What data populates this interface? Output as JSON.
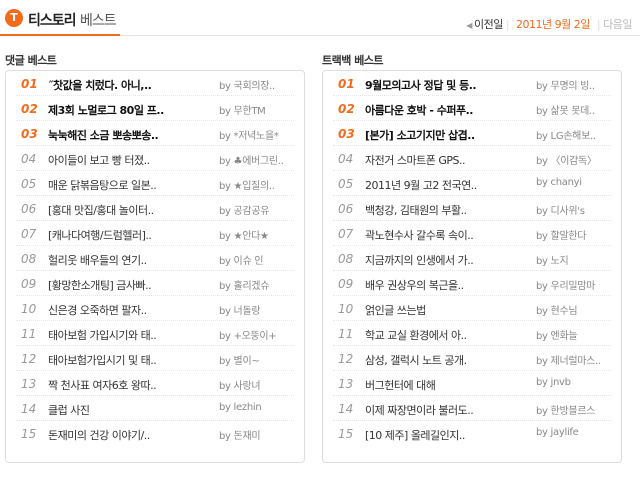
{
  "header": {
    "logo_char": "T",
    "brand_main": "티스토리",
    "brand_sub": "베스트",
    "prev_label": "이전일",
    "date": "2011년 9월 2일",
    "next_label": "다음일"
  },
  "colors": {
    "accent": "#f26b1d"
  },
  "comment_best": {
    "title": "댓글 베스트",
    "items": [
      {
        "rank": "01",
        "title": "˝찻값을 치렀다. 아니,..",
        "author": "by 국회의장.."
      },
      {
        "rank": "02",
        "title": "제3회 노멀로그 80일 프..",
        "author": "by 무한TM"
      },
      {
        "rank": "03",
        "title": "눅눅해진 소금 뽀송뽀송..",
        "author": "by *저녁노을*"
      },
      {
        "rank": "04",
        "title": "아이들이 보고 빵 터졌..",
        "author": "by ♣에버그린.."
      },
      {
        "rank": "05",
        "title": "매운 닭볶음탕으로 일본..",
        "author": "by ★입질의.."
      },
      {
        "rank": "06",
        "title": "[홍대 맛집/홍대 놀이터..",
        "author": "by 공감공유"
      },
      {
        "rank": "07",
        "title": "[캐나다여행/드럼헬러]..",
        "author": "by ★안다★"
      },
      {
        "rank": "08",
        "title": "헐리웃 배우들의 연기..",
        "author": "by 이슈 인"
      },
      {
        "rank": "09",
        "title": "[황망한소개팅] 금사빠..",
        "author": "by 홀리겠슈"
      },
      {
        "rank": "10",
        "title": "신은경 오죽하면 팔자..",
        "author": "by 너돌랑"
      },
      {
        "rank": "11",
        "title": "태아보험 가입시기와 태..",
        "author": "by +오뚱이+"
      },
      {
        "rank": "12",
        "title": "태아보험가입시기 및 태..",
        "author": "by 별이~"
      },
      {
        "rank": "13",
        "title": "짝 천사표 여자6호 왕따..",
        "author": "by 사랑녀"
      },
      {
        "rank": "14",
        "title": "클럽 사진",
        "author": "by lezhin"
      },
      {
        "rank": "15",
        "title": "돈재미의 건강 이야기/..",
        "author": "by 돈재미"
      }
    ]
  },
  "trackback_best": {
    "title": "트랙백 베스트",
    "items": [
      {
        "rank": "01",
        "title": "9월모의고사 정답 및 등..",
        "author": "by 무명의 빙.."
      },
      {
        "rank": "02",
        "title": "아름다운 호박 - 수퍼푸..",
        "author": "by 삶못 못데.."
      },
      {
        "rank": "03",
        "title": "[본가] 소고기지만 삽겹..",
        "author": "by LG손해보.."
      },
      {
        "rank": "04",
        "title": "자전거 스마트폰 GPS..",
        "author": "by 〈이감독〉"
      },
      {
        "rank": "05",
        "title": "2011년 9월 고2 전국연..",
        "author": "by chanyi"
      },
      {
        "rank": "06",
        "title": "백청강, 김태원의 부활..",
        "author": "by 디사위's"
      },
      {
        "rank": "07",
        "title": "곽노현수사 갈수록 속이..",
        "author": "by 할말한다"
      },
      {
        "rank": "08",
        "title": "지금까지의 인생에서 가..",
        "author": "by 노지"
      },
      {
        "rank": "09",
        "title": "배우 권상우의 복근을..",
        "author": "by 우리밀맘마"
      },
      {
        "rank": "10",
        "title": "얽인글 쓰는법",
        "author": "by 현수님"
      },
      {
        "rank": "11",
        "title": "학교 교실 환경에서 아..",
        "author": "by 엔화늘"
      },
      {
        "rank": "12",
        "title": "삼성, 갤럭시 노트 공개.",
        "author": "by 제너럴마스.."
      },
      {
        "rank": "13",
        "title": "버그헌터에 대해",
        "author": "by jnvb"
      },
      {
        "rank": "14",
        "title": "이제 짜장면이라 불러도..",
        "author": "by 한방블르스"
      },
      {
        "rank": "15",
        "title": "[10 제주] 올레길인지..",
        "author": "by jaylife"
      }
    ]
  }
}
